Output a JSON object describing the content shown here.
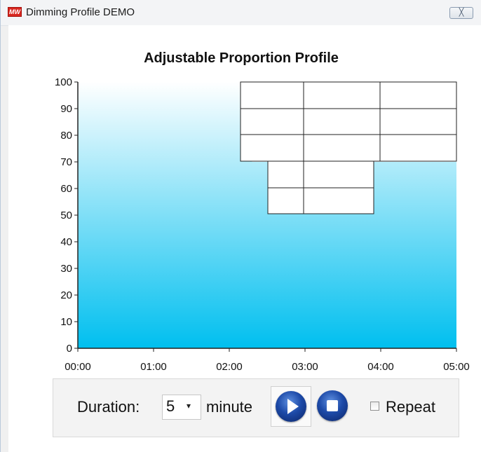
{
  "window": {
    "title": "Dimming Profile DEMO",
    "icon": "mw-logo-icon",
    "icon_text": "MW",
    "close_label": "╳"
  },
  "chart_title": "Adjustable Proportion Profile",
  "chart_data": {
    "type": "area",
    "title": "Adjustable Proportion Profile",
    "x_ticks": [
      "00:00",
      "01:00",
      "02:00",
      "03:00",
      "04:00",
      "05:00"
    ],
    "y_ticks": [
      0,
      10,
      20,
      30,
      40,
      50,
      60,
      70,
      80,
      90,
      100
    ],
    "xlim_minutes": [
      0,
      300
    ],
    "ylim": [
      0,
      100
    ],
    "series": [
      {
        "points": [
          [
            0,
            100
          ],
          [
            138,
            100
          ],
          [
            138,
            70
          ],
          [
            300,
            70
          ]
        ]
      }
    ],
    "fill_gradient": [
      "#ffffff",
      "#00bfef"
    ]
  },
  "controls": {
    "duration_label": "Duration:",
    "duration_value": "5",
    "duration_arrow": "▾",
    "unit_label": "minute",
    "play_icon": "play-icon",
    "stop_icon": "stop-icon",
    "repeat_label": "Repeat",
    "repeat_checked": false
  }
}
